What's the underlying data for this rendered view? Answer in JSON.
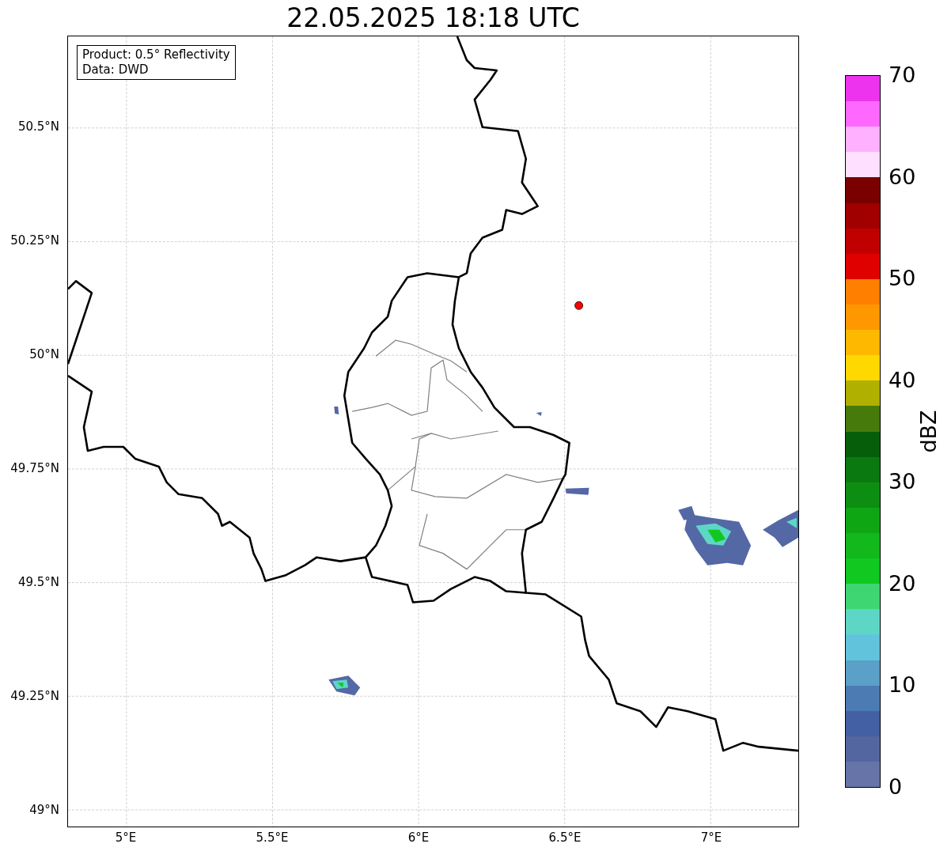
{
  "title": "22.05.2025 18:18 UTC",
  "map": {
    "legend": [
      "Product: 0.5° Reflectivity",
      "Data: DWD"
    ],
    "xtick_labels": [
      "5°E",
      "5.5°E",
      "6°E",
      "6.5°E",
      "7°E"
    ],
    "ytick_labels": [
      "50.5°N",
      "50.25°N",
      "50°N",
      "49.75°N",
      "49.5°N",
      "49.25°N",
      "49°N"
    ]
  },
  "colorbar": {
    "label": "dBZ",
    "tick_labels": [
      "70",
      "60",
      "50",
      "40",
      "30",
      "20",
      "10",
      "0"
    ],
    "bands": [
      {
        "color": "#ee33ee"
      },
      {
        "color": "#ff68ff"
      },
      {
        "color": "#ffb0ff"
      },
      {
        "color": "#ffdfff"
      },
      {
        "color": "#7a0000"
      },
      {
        "color": "#a00000"
      },
      {
        "color": "#c00000"
      },
      {
        "color": "#e00000"
      },
      {
        "color": "#ff8000"
      },
      {
        "color": "#ff9800"
      },
      {
        "color": "#ffb800"
      },
      {
        "color": "#ffd800"
      },
      {
        "color": "#b0b000"
      },
      {
        "color": "#467a0a"
      },
      {
        "color": "#075e0a"
      },
      {
        "color": "#0a7a10"
      },
      {
        "color": "#0d8e12"
      },
      {
        "color": "#0fa614"
      },
      {
        "color": "#12b81c"
      },
      {
        "color": "#10c820"
      },
      {
        "color": "#3ed672"
      },
      {
        "color": "#5ed6c6"
      },
      {
        "color": "#62c4dc"
      },
      {
        "color": "#5aa0c8"
      },
      {
        "color": "#4c7bb3"
      },
      {
        "color": "#4460a4"
      },
      {
        "color": "#5466a0"
      },
      {
        "color": "#6674a8"
      }
    ]
  }
}
